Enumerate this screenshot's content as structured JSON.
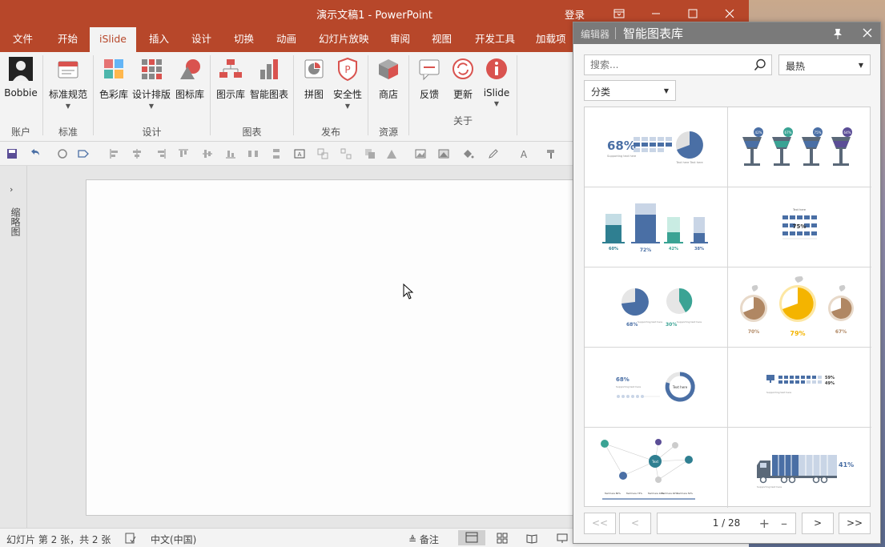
{
  "window": {
    "title": "演示文稿1  -  PowerPoint",
    "signin": "登录"
  },
  "tabs": [
    "文件",
    "开始",
    "iSlide",
    "插入",
    "设计",
    "切换",
    "动画",
    "幻灯片放映",
    "审阅",
    "视图",
    "开发工具",
    "加载项"
  ],
  "active_tab": "iSlide",
  "ribbon": {
    "buttons": {
      "user": "Bobbie",
      "standard": "标准规范",
      "color": "色彩库",
      "layout": "设计排版",
      "iconlib": "图标库",
      "diagram": "图示库",
      "smartchart": "智能图表",
      "puzzle": "拼图",
      "security": "安全性",
      "store": "商店",
      "feedback": "反馈",
      "update": "更新",
      "islide": "iSlide"
    },
    "groups": {
      "account": "账户",
      "standard": "标准",
      "design": "设计",
      "chart": "图表",
      "publish": "发布",
      "resource": "资源",
      "about": "关于"
    }
  },
  "left_pane": {
    "label": "缩略图"
  },
  "status_bar": {
    "slide_info": "幻灯片 第 2 张，共 2 张",
    "language": "中文(中国)",
    "notes": "备注"
  },
  "panel": {
    "editor_label": "编辑器",
    "title": "智能图表库",
    "search_placeholder": "搜索...",
    "sort_value": "最热",
    "category_value": "分类",
    "pager": {
      "first": "<<",
      "prev": "<",
      "page": "1 / 28",
      "next": ">",
      "last": ">>"
    },
    "thumbnails": [
      {
        "name": "thumb-pie-68",
        "texts": [
          "68%",
          "Supporting text here",
          "Text here  Text here"
        ]
      },
      {
        "name": "thumb-cups",
        "texts": [
          "42%",
          "67%",
          "75%",
          "64%"
        ]
      },
      {
        "name": "thumb-buildings",
        "texts": [
          "60%",
          "72%",
          "42%",
          "38%"
        ]
      },
      {
        "name": "thumb-people-75",
        "texts": [
          "Text here",
          "75%"
        ]
      },
      {
        "name": "thumb-two-pies",
        "texts": [
          "68%",
          "Supporting text here",
          "30%",
          "Supporting text here"
        ]
      },
      {
        "name": "thumb-oranges",
        "texts": [
          "70%",
          "79%",
          "67%"
        ]
      },
      {
        "name": "thumb-donut",
        "texts": [
          "68%",
          "Supporting text here",
          "Text here"
        ]
      },
      {
        "name": "thumb-monitor-bar",
        "texts": [
          "59%",
          "49%",
          "Supporting text here"
        ]
      },
      {
        "name": "thumb-network",
        "texts": [
          "Text",
          "Text here 80%",
          "Text here 73%",
          "Text here 16%",
          "Text here 40%",
          "Text here 54%"
        ]
      },
      {
        "name": "thumb-truck",
        "texts": [
          "41%",
          "Supporting text here"
        ]
      }
    ]
  },
  "colors": {
    "ppt_accent": "#b7472a",
    "chart_blue": "#4a6fa5",
    "chart_teal": "#3aa394",
    "chart_purple": "#5b4e96",
    "chart_orange": "#f4b400",
    "chart_brown": "#b08763"
  }
}
